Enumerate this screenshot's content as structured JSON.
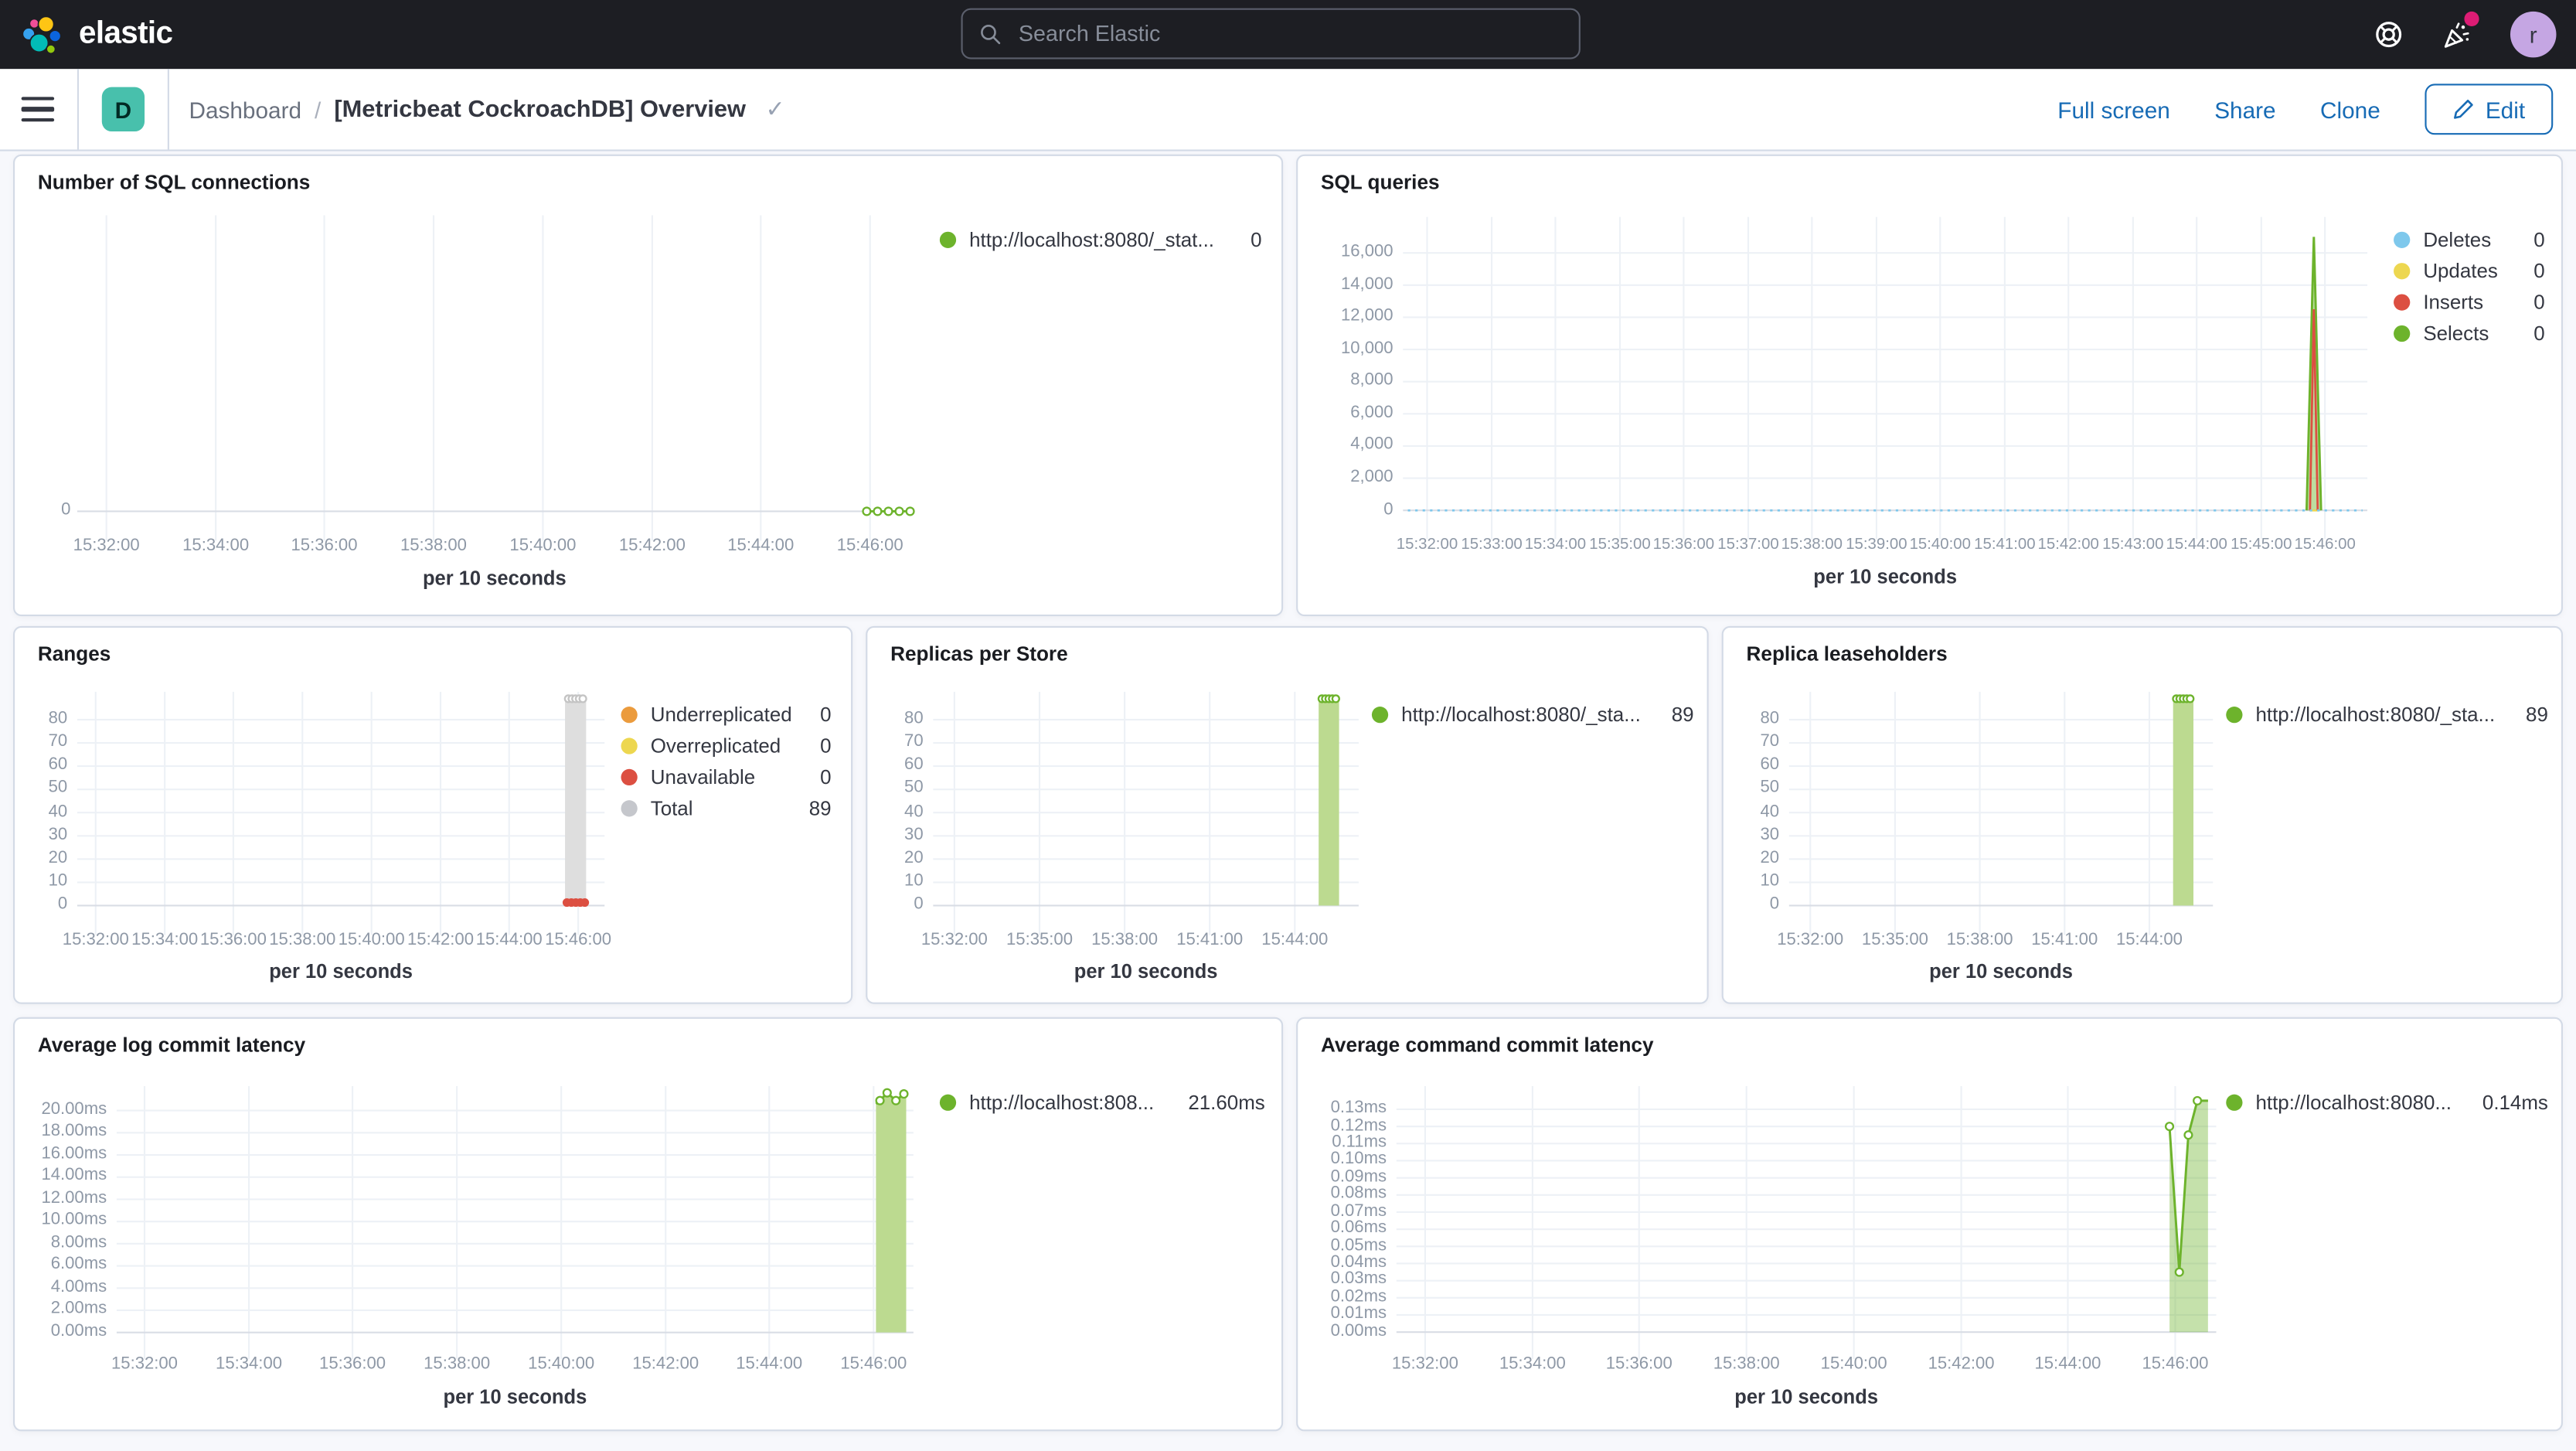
{
  "topbar": {
    "brand": "elastic",
    "search_placeholder": "Search Elastic",
    "avatar_initial": "r"
  },
  "navbar": {
    "badge": "D",
    "breadcrumb_root": "Dashboard",
    "breadcrumb_sep": "/",
    "title": "[Metricbeat CockroachDB] Overview",
    "title_check": "✓",
    "actions": [
      "Full screen",
      "Share",
      "Clone"
    ],
    "edit_label": "Edit"
  },
  "colors": {
    "green": "#6db32c",
    "light_green_fill": "#bcda90",
    "blue": "#7ec8ec",
    "yellow": "#edd750",
    "red": "#dc4f41",
    "orange": "#eb9b3d",
    "grey": "#c5c7cc",
    "grey_bar": "#dedede",
    "accent_blue": "#176bb5",
    "teal_badge": "#48c0ac",
    "notification_pink": "#dd1c74"
  },
  "panels": [
    {
      "title": "Number of SQL connections",
      "x_label": "per 10 seconds",
      "legend": [
        {
          "label": "http://localhost:8080/_stat...",
          "value": "0",
          "color": "#6db32c"
        }
      ],
      "chart_data": {
        "type": "line",
        "ylim": [
          -0.6,
          11
        ],
        "y_ticks": [
          {
            "v": 0,
            "label": "0"
          }
        ],
        "x_tick_labels": [
          "15:32:00",
          "15:34:00",
          "15:36:00",
          "15:38:00",
          "15:40:00",
          "15:42:00",
          "15:44:00",
          "15:46:00"
        ],
        "x_tick_fracs": [
          0.035,
          0.166,
          0.296,
          0.427,
          0.558,
          0.689,
          0.819,
          0.95
        ],
        "series": [
          {
            "name": "http://localhost:8080/_stat...",
            "type": "line",
            "color": "#6db32c",
            "marker": "hollow",
            "points": [
              [
                0.946,
                0
              ],
              [
                0.959,
                0
              ],
              [
                0.972,
                0
              ],
              [
                0.985,
                0
              ],
              [
                0.998,
                0
              ]
            ]
          }
        ]
      }
    },
    {
      "title": "SQL queries",
      "x_label": "per 10 seconds",
      "legend": [
        {
          "label": "Deletes",
          "value": "0",
          "color": "#7ec8ec"
        },
        {
          "label": "Updates",
          "value": "0",
          "color": "#edd750"
        },
        {
          "label": "Inserts",
          "value": "0",
          "color": "#dc4f41"
        },
        {
          "label": "Selects",
          "value": "0",
          "color": "#6db32c"
        }
      ],
      "chart_data": {
        "type": "line",
        "ylim": [
          -960,
          18240
        ],
        "y_ticks": [
          {
            "v": 0,
            "label": "0"
          },
          {
            "v": 2000,
            "label": "2,000"
          },
          {
            "v": 4000,
            "label": "4,000"
          },
          {
            "v": 6000,
            "label": "6,000"
          },
          {
            "v": 8000,
            "label": "8,000"
          },
          {
            "v": 10000,
            "label": "10,000"
          },
          {
            "v": 12000,
            "label": "12,000"
          },
          {
            "v": 14000,
            "label": "14,000"
          },
          {
            "v": 16000,
            "label": "16,000"
          }
        ],
        "x_tick_labels": [
          "15:32:00",
          "15:33:00",
          "15:34:00",
          "15:35:00",
          "15:36:00",
          "15:37:00",
          "15:38:00",
          "15:39:00",
          "15:40:00",
          "15:41:00",
          "15:42:00",
          "15:43:00",
          "15:44:00",
          "15:45:00",
          "15:46:00"
        ],
        "x_tick_fracs": [
          0.025,
          0.092,
          0.158,
          0.225,
          0.291,
          0.358,
          0.424,
          0.491,
          0.557,
          0.624,
          0.69,
          0.757,
          0.823,
          0.89,
          0.956
        ],
        "series": [
          {
            "name": "Selects spike",
            "type": "area",
            "color": "#6db32c",
            "fill": "rgba(109,179,44,0.45)",
            "points": [
              [
                0.937,
                0
              ],
              [
                0.9445,
                17000
              ],
              [
                0.952,
                0
              ]
            ]
          },
          {
            "name": "Updates",
            "type": "line",
            "color": "#edd750",
            "points": [
              [
                0.94,
                0
              ],
              [
                0.949,
                0
              ]
            ]
          },
          {
            "name": "Inserts spike",
            "type": "line",
            "color": "#dc4f41",
            "points": [
              [
                0.9405,
                0
              ],
              [
                0.9445,
                12500
              ],
              [
                0.9485,
                0
              ]
            ]
          },
          {
            "name": "Deletes",
            "type": "line",
            "color": "#7ec8ec",
            "dash": "1.5 3",
            "points": [
              [
                0.005,
                0
              ],
              [
                0.995,
                0
              ]
            ]
          }
        ]
      }
    },
    {
      "title": "Ranges",
      "x_label": "per 10 seconds",
      "legend": [
        {
          "label": "Underreplicated",
          "value": "0",
          "color": "#eb9b3d"
        },
        {
          "label": "Overreplicated",
          "value": "0",
          "color": "#edd750"
        },
        {
          "label": "Unavailable",
          "value": "0",
          "color": "#dc4f41"
        },
        {
          "label": "Total",
          "value": "89",
          "color": "#c5c7cc"
        }
      ],
      "chart_data": {
        "type": "bar",
        "ylim": [
          -7,
          92
        ],
        "y_ticks": [
          {
            "v": 0,
            "label": "0"
          },
          {
            "v": 10,
            "label": "10"
          },
          {
            "v": 20,
            "label": "20"
          },
          {
            "v": 30,
            "label": "30"
          },
          {
            "v": 40,
            "label": "40"
          },
          {
            "v": 50,
            "label": "50"
          },
          {
            "v": 60,
            "label": "60"
          },
          {
            "v": 70,
            "label": "70"
          },
          {
            "v": 80,
            "label": "80"
          }
        ],
        "x_tick_labels": [
          "15:32:00",
          "15:34:00",
          "15:36:00",
          "15:38:00",
          "15:40:00",
          "15:42:00",
          "15:44:00",
          "15:46:00"
        ],
        "x_tick_fracs": [
          0.035,
          0.166,
          0.296,
          0.427,
          0.558,
          0.689,
          0.819,
          0.95
        ],
        "series": [
          {
            "name": "Total",
            "type": "bar",
            "color": "#dedede",
            "x": 0.945,
            "w": 0.04,
            "y": 89,
            "marker": "hollow",
            "marker_color": "#c4c4c4",
            "marker_n": 5
          },
          {
            "name": "Unavailable",
            "type": "dots",
            "color": "#dc4f41",
            "points": [
              [
                0.9285,
                1.3
              ],
              [
                0.937,
                1.3
              ],
              [
                0.9455,
                1.3
              ],
              [
                0.954,
                1.3
              ],
              [
                0.9625,
                1.3
              ]
            ]
          }
        ]
      }
    },
    {
      "title": "Replicas per Store",
      "x_label": "per 10 seconds",
      "legend": [
        {
          "label": "http://localhost:8080/_sta...",
          "value": "89",
          "color": "#6db32c"
        }
      ],
      "chart_data": {
        "type": "bar",
        "ylim": [
          -7,
          92
        ],
        "y_ticks": [
          {
            "v": 0,
            "label": "0"
          },
          {
            "v": 10,
            "label": "10"
          },
          {
            "v": 20,
            "label": "20"
          },
          {
            "v": 30,
            "label": "30"
          },
          {
            "v": 40,
            "label": "40"
          },
          {
            "v": 50,
            "label": "50"
          },
          {
            "v": 60,
            "label": "60"
          },
          {
            "v": 70,
            "label": "70"
          },
          {
            "v": 80,
            "label": "80"
          }
        ],
        "x_tick_labels": [
          "15:32:00",
          "15:35:00",
          "15:38:00",
          "15:41:00",
          "15:44:00"
        ],
        "x_tick_fracs": [
          0.05,
          0.25,
          0.45,
          0.65,
          0.85
        ],
        "series": [
          {
            "name": "http://localhost:8080/_sta...",
            "type": "bar",
            "color": "#bcda90",
            "x": 0.93,
            "w": 0.048,
            "y": 89,
            "marker": "hollow",
            "marker_color": "#6db32c",
            "marker_n": 5
          }
        ]
      }
    },
    {
      "title": "Replica leaseholders",
      "x_label": "per 10 seconds",
      "legend": [
        {
          "label": "http://localhost:8080/_sta...",
          "value": "89",
          "color": "#6db32c"
        }
      ],
      "chart_data": {
        "type": "bar",
        "ylim": [
          -7,
          92
        ],
        "y_ticks": [
          {
            "v": 0,
            "label": "0"
          },
          {
            "v": 10,
            "label": "10"
          },
          {
            "v": 20,
            "label": "20"
          },
          {
            "v": 30,
            "label": "30"
          },
          {
            "v": 40,
            "label": "40"
          },
          {
            "v": 50,
            "label": "50"
          },
          {
            "v": 60,
            "label": "60"
          },
          {
            "v": 70,
            "label": "70"
          },
          {
            "v": 80,
            "label": "80"
          }
        ],
        "x_tick_labels": [
          "15:32:00",
          "15:35:00",
          "15:38:00",
          "15:41:00",
          "15:44:00"
        ],
        "x_tick_fracs": [
          0.05,
          0.25,
          0.45,
          0.65,
          0.85
        ],
        "series": [
          {
            "name": "http://localhost:8080/_sta...",
            "type": "bar",
            "color": "#bcda90",
            "x": 0.93,
            "w": 0.048,
            "y": 89,
            "marker": "hollow",
            "marker_color": "#6db32c",
            "marker_n": 5
          }
        ]
      }
    },
    {
      "title": "Average log commit latency",
      "x_label": "per 10 seconds",
      "legend": [
        {
          "label": "http://localhost:808...",
          "value": "21.60ms",
          "color": "#6db32c"
        }
      ],
      "chart_data": {
        "type": "area",
        "ylim": [
          -1.2,
          22.2
        ],
        "y_ticks": [
          {
            "v": 0,
            "label": "0.00ms"
          },
          {
            "v": 2,
            "label": "2.00ms"
          },
          {
            "v": 4,
            "label": "4.00ms"
          },
          {
            "v": 6,
            "label": "6.00ms"
          },
          {
            "v": 8,
            "label": "8.00ms"
          },
          {
            "v": 10,
            "label": "10.00ms"
          },
          {
            "v": 12,
            "label": "12.00ms"
          },
          {
            "v": 14,
            "label": "14.00ms"
          },
          {
            "v": 16,
            "label": "16.00ms"
          },
          {
            "v": 18,
            "label": "18.00ms"
          },
          {
            "v": 20,
            "label": "20.00ms"
          }
        ],
        "x_tick_labels": [
          "15:32:00",
          "15:34:00",
          "15:36:00",
          "15:38:00",
          "15:40:00",
          "15:42:00",
          "15:44:00",
          "15:46:00"
        ],
        "x_tick_fracs": [
          0.035,
          0.166,
          0.296,
          0.427,
          0.558,
          0.689,
          0.819,
          0.95
        ],
        "series": [
          {
            "name": "http://localhost:808...",
            "type": "area",
            "color": "#6db32c",
            "fill": "#bcda90",
            "points": [
              [
                0.953,
                20.6
              ],
              [
                0.958,
                20.9
              ],
              [
                0.967,
                21.6
              ],
              [
                0.978,
                20.9
              ],
              [
                0.988,
                21.5
              ],
              [
                0.991,
                21.3
              ]
            ],
            "marker": "hollow",
            "marker_points": [
              [
                0.958,
                20.9
              ],
              [
                0.967,
                21.6
              ],
              [
                0.978,
                20.9
              ],
              [
                0.988,
                21.5
              ]
            ]
          }
        ]
      }
    },
    {
      "title": "Average command commit latency",
      "x_label": "per 10 seconds",
      "legend": [
        {
          "label": "http://localhost:8080...",
          "value": "0.14ms",
          "color": "#6db32c"
        }
      ],
      "chart_data": {
        "type": "area",
        "ylim": [
          -0.008,
          0.1435
        ],
        "y_ticks": [
          {
            "v": 0,
            "label": "0.00ms"
          },
          {
            "v": 0.01,
            "label": "0.01ms"
          },
          {
            "v": 0.02,
            "label": "0.02ms"
          },
          {
            "v": 0.03,
            "label": "0.03ms"
          },
          {
            "v": 0.04,
            "label": "0.04ms"
          },
          {
            "v": 0.05,
            "label": "0.05ms"
          },
          {
            "v": 0.06,
            "label": "0.06ms"
          },
          {
            "v": 0.07,
            "label": "0.07ms"
          },
          {
            "v": 0.08,
            "label": "0.08ms"
          },
          {
            "v": 0.09,
            "label": "0.09ms"
          },
          {
            "v": 0.1,
            "label": "0.10ms"
          },
          {
            "v": 0.11,
            "label": "0.11ms"
          },
          {
            "v": 0.12,
            "label": "0.12ms"
          },
          {
            "v": 0.13,
            "label": "0.13ms"
          }
        ],
        "x_tick_labels": [
          "15:32:00",
          "15:34:00",
          "15:36:00",
          "15:38:00",
          "15:40:00",
          "15:42:00",
          "15:44:00",
          "15:46:00"
        ],
        "x_tick_fracs": [
          0.035,
          0.166,
          0.296,
          0.427,
          0.558,
          0.689,
          0.819,
          0.95
        ],
        "series": [
          {
            "name": "http://localhost:8080...",
            "type": "area",
            "color": "#6db32c",
            "fill": "rgba(109,179,44,0.4)",
            "points": [
              [
                0.943,
                0.12
              ],
              [
                0.955,
                0.035
              ],
              [
                0.966,
                0.115
              ],
              [
                0.977,
                0.135
              ],
              [
                0.99,
                0.135
              ]
            ],
            "marker": "hollow",
            "marker_points": [
              [
                0.943,
                0.12
              ],
              [
                0.955,
                0.035
              ],
              [
                0.966,
                0.115
              ],
              [
                0.977,
                0.135
              ]
            ]
          }
        ]
      }
    }
  ]
}
